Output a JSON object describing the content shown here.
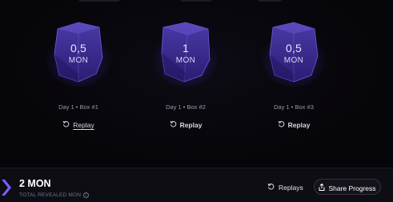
{
  "boxes": [
    {
      "amount": "0,5",
      "unit": "MON",
      "label": "Day 1 • Box #1",
      "replay_label": "Replay",
      "replay_style": "underlined"
    },
    {
      "amount": "1",
      "unit": "MON",
      "label": "Day 1 • Box #2",
      "replay_label": "Replay",
      "replay_style": "bold"
    },
    {
      "amount": "0,5",
      "unit": "MON",
      "label": "Day 1 • Box #3",
      "replay_label": "Replay",
      "replay_style": "bold"
    }
  ],
  "footer": {
    "total_value": "2 MON",
    "total_label": "TOTAL REVEALED MON",
    "info_glyph": "i",
    "replays_label": "Replays",
    "share_label": "Share Progress"
  },
  "icons": {
    "box": "cube-icon",
    "replay": "replay-icon",
    "info": "info-icon",
    "share": "share-icon",
    "accent": "chevron-accent-icon"
  },
  "colors": {
    "background": "#07060a",
    "cube_fill": "#3a2a8c",
    "cube_glow": "#6a3cff",
    "accent_purple": "#7b5cff",
    "text_primary": "#ffffff",
    "text_muted": "#9b97a8"
  }
}
